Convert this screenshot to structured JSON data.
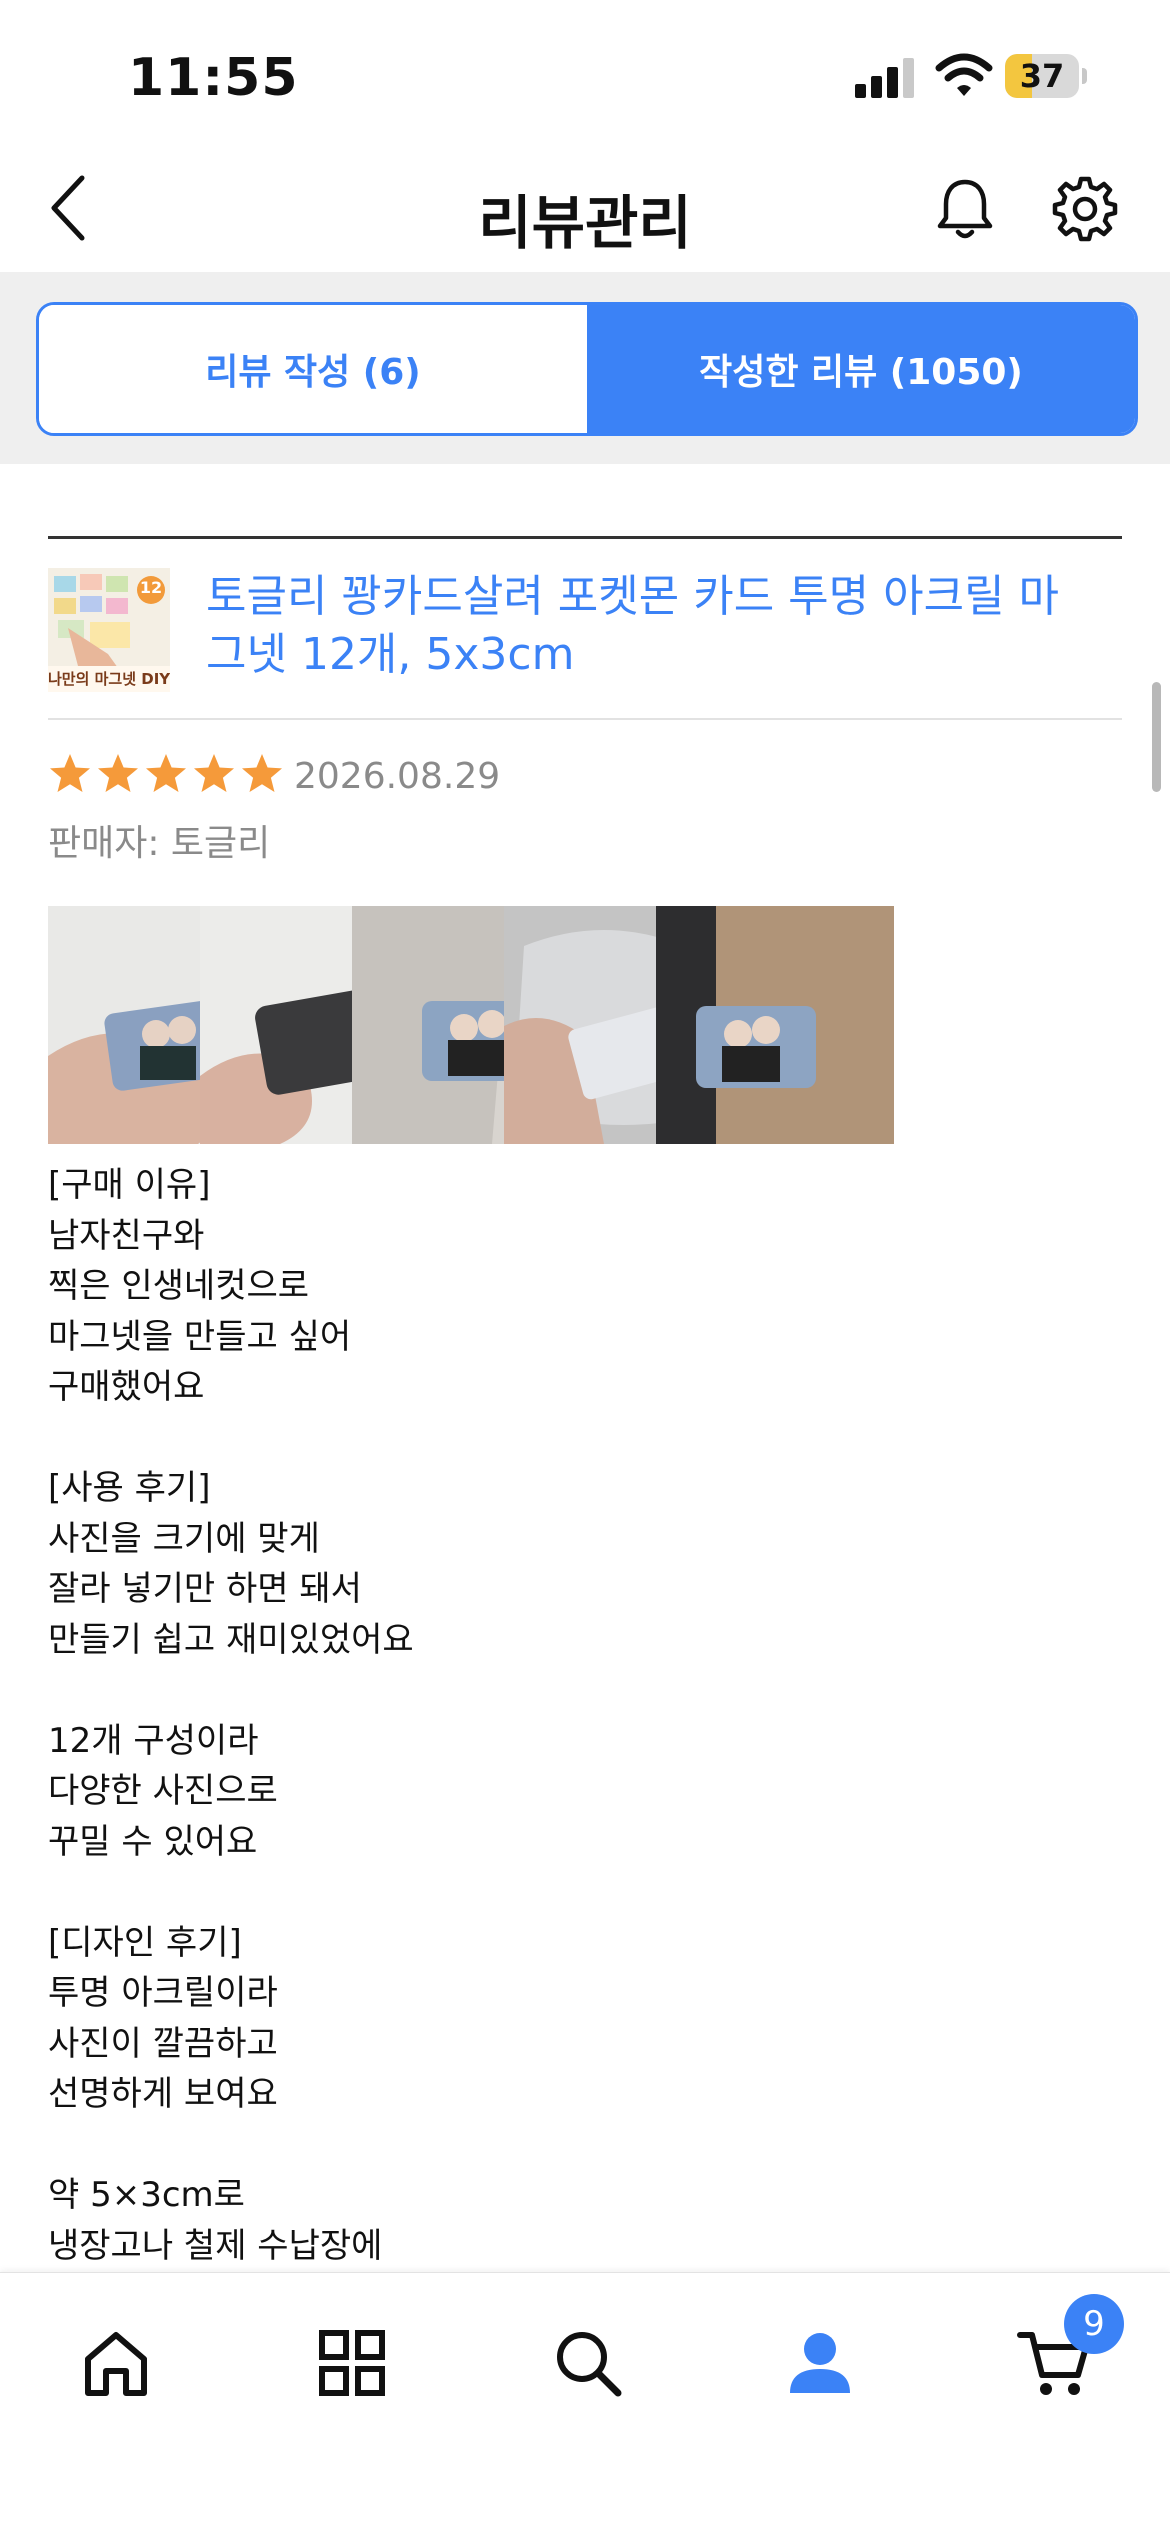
{
  "status_bar": {
    "time": "11:55",
    "battery": "37",
    "battery_level": 0.37
  },
  "header": {
    "title": "리뷰관리"
  },
  "tabs": [
    {
      "label": "리뷰 작성 (6)",
      "active": false
    },
    {
      "label": "작성한 리뷰 (1050)",
      "active": true
    }
  ],
  "review": {
    "product_title": "토글리 꽝카드살려 포켓몬 카드 투명 아크릴 마그넷 12개, 5x3cm",
    "thumb_badge": "12",
    "thumb_caption": "나만의 마그넷 DIY",
    "rating": 5,
    "date": "2026.08.29",
    "seller": "판매자: 토글리",
    "body": "[구매 이유]\n남자친구와\n찍은 인생네컷으로\n마그넷을 만들고 싶어\n구매했어요\n\n[사용 후기]\n사진을 크기에 맞게\n잘라 넣기만 하면 돼서\n만들기 쉽고 재미있었어요\n\n12개 구성이라\n다양한 사진으로\n꾸밀 수 있어요\n\n[디자인 후기]\n투명 아크릴이라\n사진이 깔끔하고\n선명하게 보여요\n\n약 5×3cm로\n냉장고나 철제 수납장에"
  },
  "bottom_nav": {
    "cart_badge": "9"
  },
  "colors": {
    "accent": "#3b82f6",
    "star": "#f59a3a",
    "muted": "#8a8a8a"
  }
}
